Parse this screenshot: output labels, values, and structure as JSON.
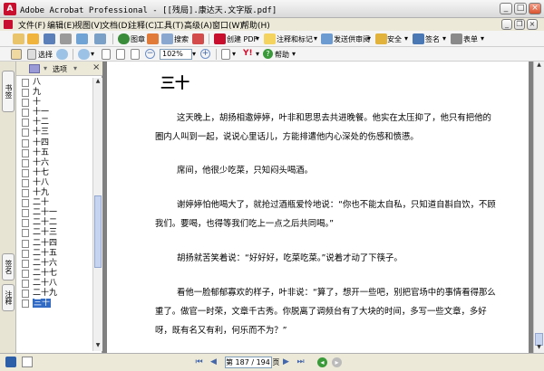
{
  "window": {
    "title": "Adobe Acrobat Professional - [[残局].康达天.文字版.pdf]",
    "app_icon": "acrobat-icon",
    "accent_color": "#c8102e"
  },
  "menu": [
    "文件(F)",
    "编辑(E)",
    "视图(V)",
    "文档(D)",
    "注释(C)",
    "工具(T)",
    "高级(A)",
    "窗口(W)",
    "帮助(H)"
  ],
  "toolbar1": {
    "search_label": "搜索",
    "create_pdf_label": "创建 PDF",
    "comment_label": "注释和标记",
    "review_label": "发送供审阅",
    "security_label": "安全",
    "sign_label": "签名",
    "forms_label": "表单",
    "icon_label": "图章"
  },
  "toolbar2": {
    "select_label": "选择",
    "zoom_value": "102%",
    "help_label": "帮助"
  },
  "left_tabs": [
    "书签",
    "签名",
    "注释"
  ],
  "bookmarks": {
    "options_label": "选项",
    "items": [
      "八",
      "九",
      "十",
      "十一",
      "十二",
      "十三",
      "十四",
      "十五",
      "十六",
      "十七",
      "十八",
      "十九",
      "二十",
      "二十一",
      "二十二",
      "二十三",
      "二十四",
      "二十五",
      "二十六",
      "二十七",
      "二十八",
      "二十九",
      "三十"
    ],
    "selected": "三十"
  },
  "document": {
    "heading": "三十",
    "paragraphs": [
      "这天晚上，胡扬相邀婷婷，叶非和思思去共进晚餐。他实在太压抑了，他只有把他的圈内人叫到一起，说说心里话儿，方能排遣他内心深处的伤感和愤懑。",
      "席间，他很少吃菜，只知闷头喝酒。",
      "谢婷婷怕他喝大了，就抢过酒瓶爱怜地说：“你也不能太自私，只知道自斟自饮，不顾我们。要喝，也得等我们吃上一点之后共同喝。”",
      "胡扬就苦笑着说：“好好好，吃菜吃菜。”说着才动了下筷子。",
      "看他一脸郁郁寡欢的样子，叶非说：“算了，想开一些吧，别把官场中的事情看得那么重了。做官一时荣，文章千古秀。你脱离了调频台有了大块的时间，多写一些文章，多好呀，既有名又有利，何乐而不为？”"
    ]
  },
  "status": {
    "page_display": "第 187 / 194 页",
    "current_page": 187,
    "total_pages": 194
  }
}
